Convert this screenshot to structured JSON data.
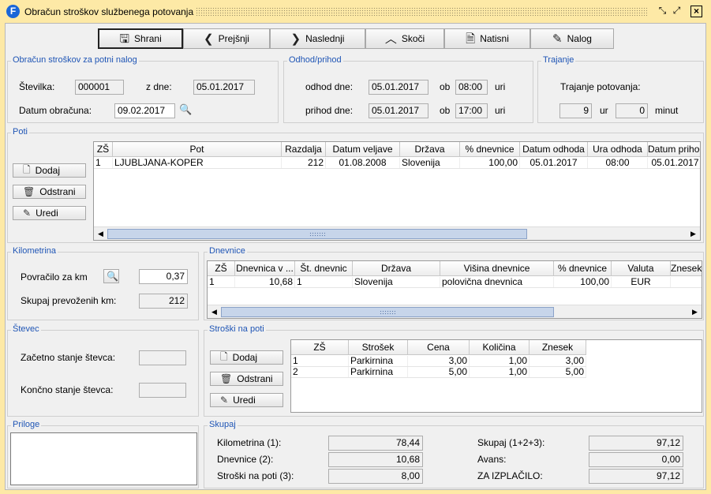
{
  "window": {
    "title": "Obračun stroškov službenega potovanja"
  },
  "toolbar": {
    "save": "Shrani",
    "prev": "Prejšnji",
    "next": "Naslednji",
    "jump": "Skoči",
    "print": "Natisni",
    "order": "Nalog"
  },
  "obracun": {
    "legend": "Obračun stroškov za potni nalog",
    "stevilka_label": "Številka:",
    "stevilka": "000001",
    "zdne_label": "z dne:",
    "zdne": "05.01.2017",
    "datum_label": "Datum obračuna:",
    "datum": "09.02.2017"
  },
  "odhod": {
    "legend": "Odhod/prihod",
    "odhod_label": "odhod dne:",
    "odhod_datum": "05.01.2017",
    "prihod_label": "prihod dne:",
    "prihod_datum": "05.01.2017",
    "ob": "ob",
    "odhod_ura": "08:00",
    "prihod_ura": "17:00",
    "uri": "uri"
  },
  "trajanje": {
    "legend": "Trajanje",
    "label": "Trajanje potovanja:",
    "ure": "9",
    "ur": "ur",
    "minute": "0",
    "minut": "minut"
  },
  "poti": {
    "legend": "Poti",
    "add": "Dodaj",
    "remove": "Odstrani",
    "edit": "Uredi",
    "columns": [
      "ZŠ",
      "Pot",
      "Razdalja",
      "Datum veljave",
      "Država",
      "% dnevnice",
      "Datum odhoda",
      "Ura odhoda",
      "Datum prihoda"
    ],
    "rows": [
      [
        "1",
        "LJUBLJANA-KOPER",
        "212",
        "01.08.2008",
        "Slovenija",
        "100,00",
        "05.01.2017",
        "08:00",
        "05.01.2017"
      ]
    ]
  },
  "kilometrina": {
    "legend": "Kilometrina",
    "povracilo_label": "Povračilo za km",
    "povracilo": "0,37",
    "skupaj_label": "Skupaj prevoženih km:",
    "skupaj": "212"
  },
  "dnevnice": {
    "legend": "Dnevnice",
    "columns": [
      "ZŠ",
      "Dnevnica v ...",
      "Št. dnevnic",
      "Država",
      "Višina dnevnice",
      "% dnevnice",
      "Valuta",
      "Znesek"
    ],
    "rows": [
      [
        "1",
        "10,68",
        "1",
        "Slovenija",
        "polovična dnevnica",
        "100,00",
        "EUR",
        ""
      ]
    ]
  },
  "stevec": {
    "legend": "Števec",
    "zacetno_label": "Začetno stanje števca:",
    "zacetno": "",
    "koncno_label": "Končno stanje števca:",
    "koncno": ""
  },
  "stroski": {
    "legend": "Stroški na poti",
    "add": "Dodaj",
    "remove": "Odstrani",
    "edit": "Uredi",
    "columns": [
      "ZŠ",
      "Strošek",
      "Cena",
      "Količina",
      "Znesek"
    ],
    "rows": [
      [
        "1",
        "Parkirnina",
        "3,00",
        "1,00",
        "3,00"
      ],
      [
        "2",
        "Parkirnina",
        "5,00",
        "1,00",
        "5,00"
      ]
    ]
  },
  "priloge": {
    "legend": "Priloge"
  },
  "skupaj": {
    "legend": "Skupaj",
    "km_label": "Kilometrina (1):",
    "km": "78,44",
    "dn_label": "Dnevnice (2):",
    "dn": "10,68",
    "sp_label": "Stroški na poti (3):",
    "sp": "8,00",
    "sum_label": "Skupaj (1+2+3):",
    "sum": "97,12",
    "avans_label": "Avans:",
    "avans": "0,00",
    "izpl_label": "ZA IZPLAČILO:",
    "izpl": "97,12"
  },
  "colors": {
    "window_bg": "#fde9a6",
    "legend": "#1f55b5",
    "scroll_thumb": "#c7d5ea"
  }
}
